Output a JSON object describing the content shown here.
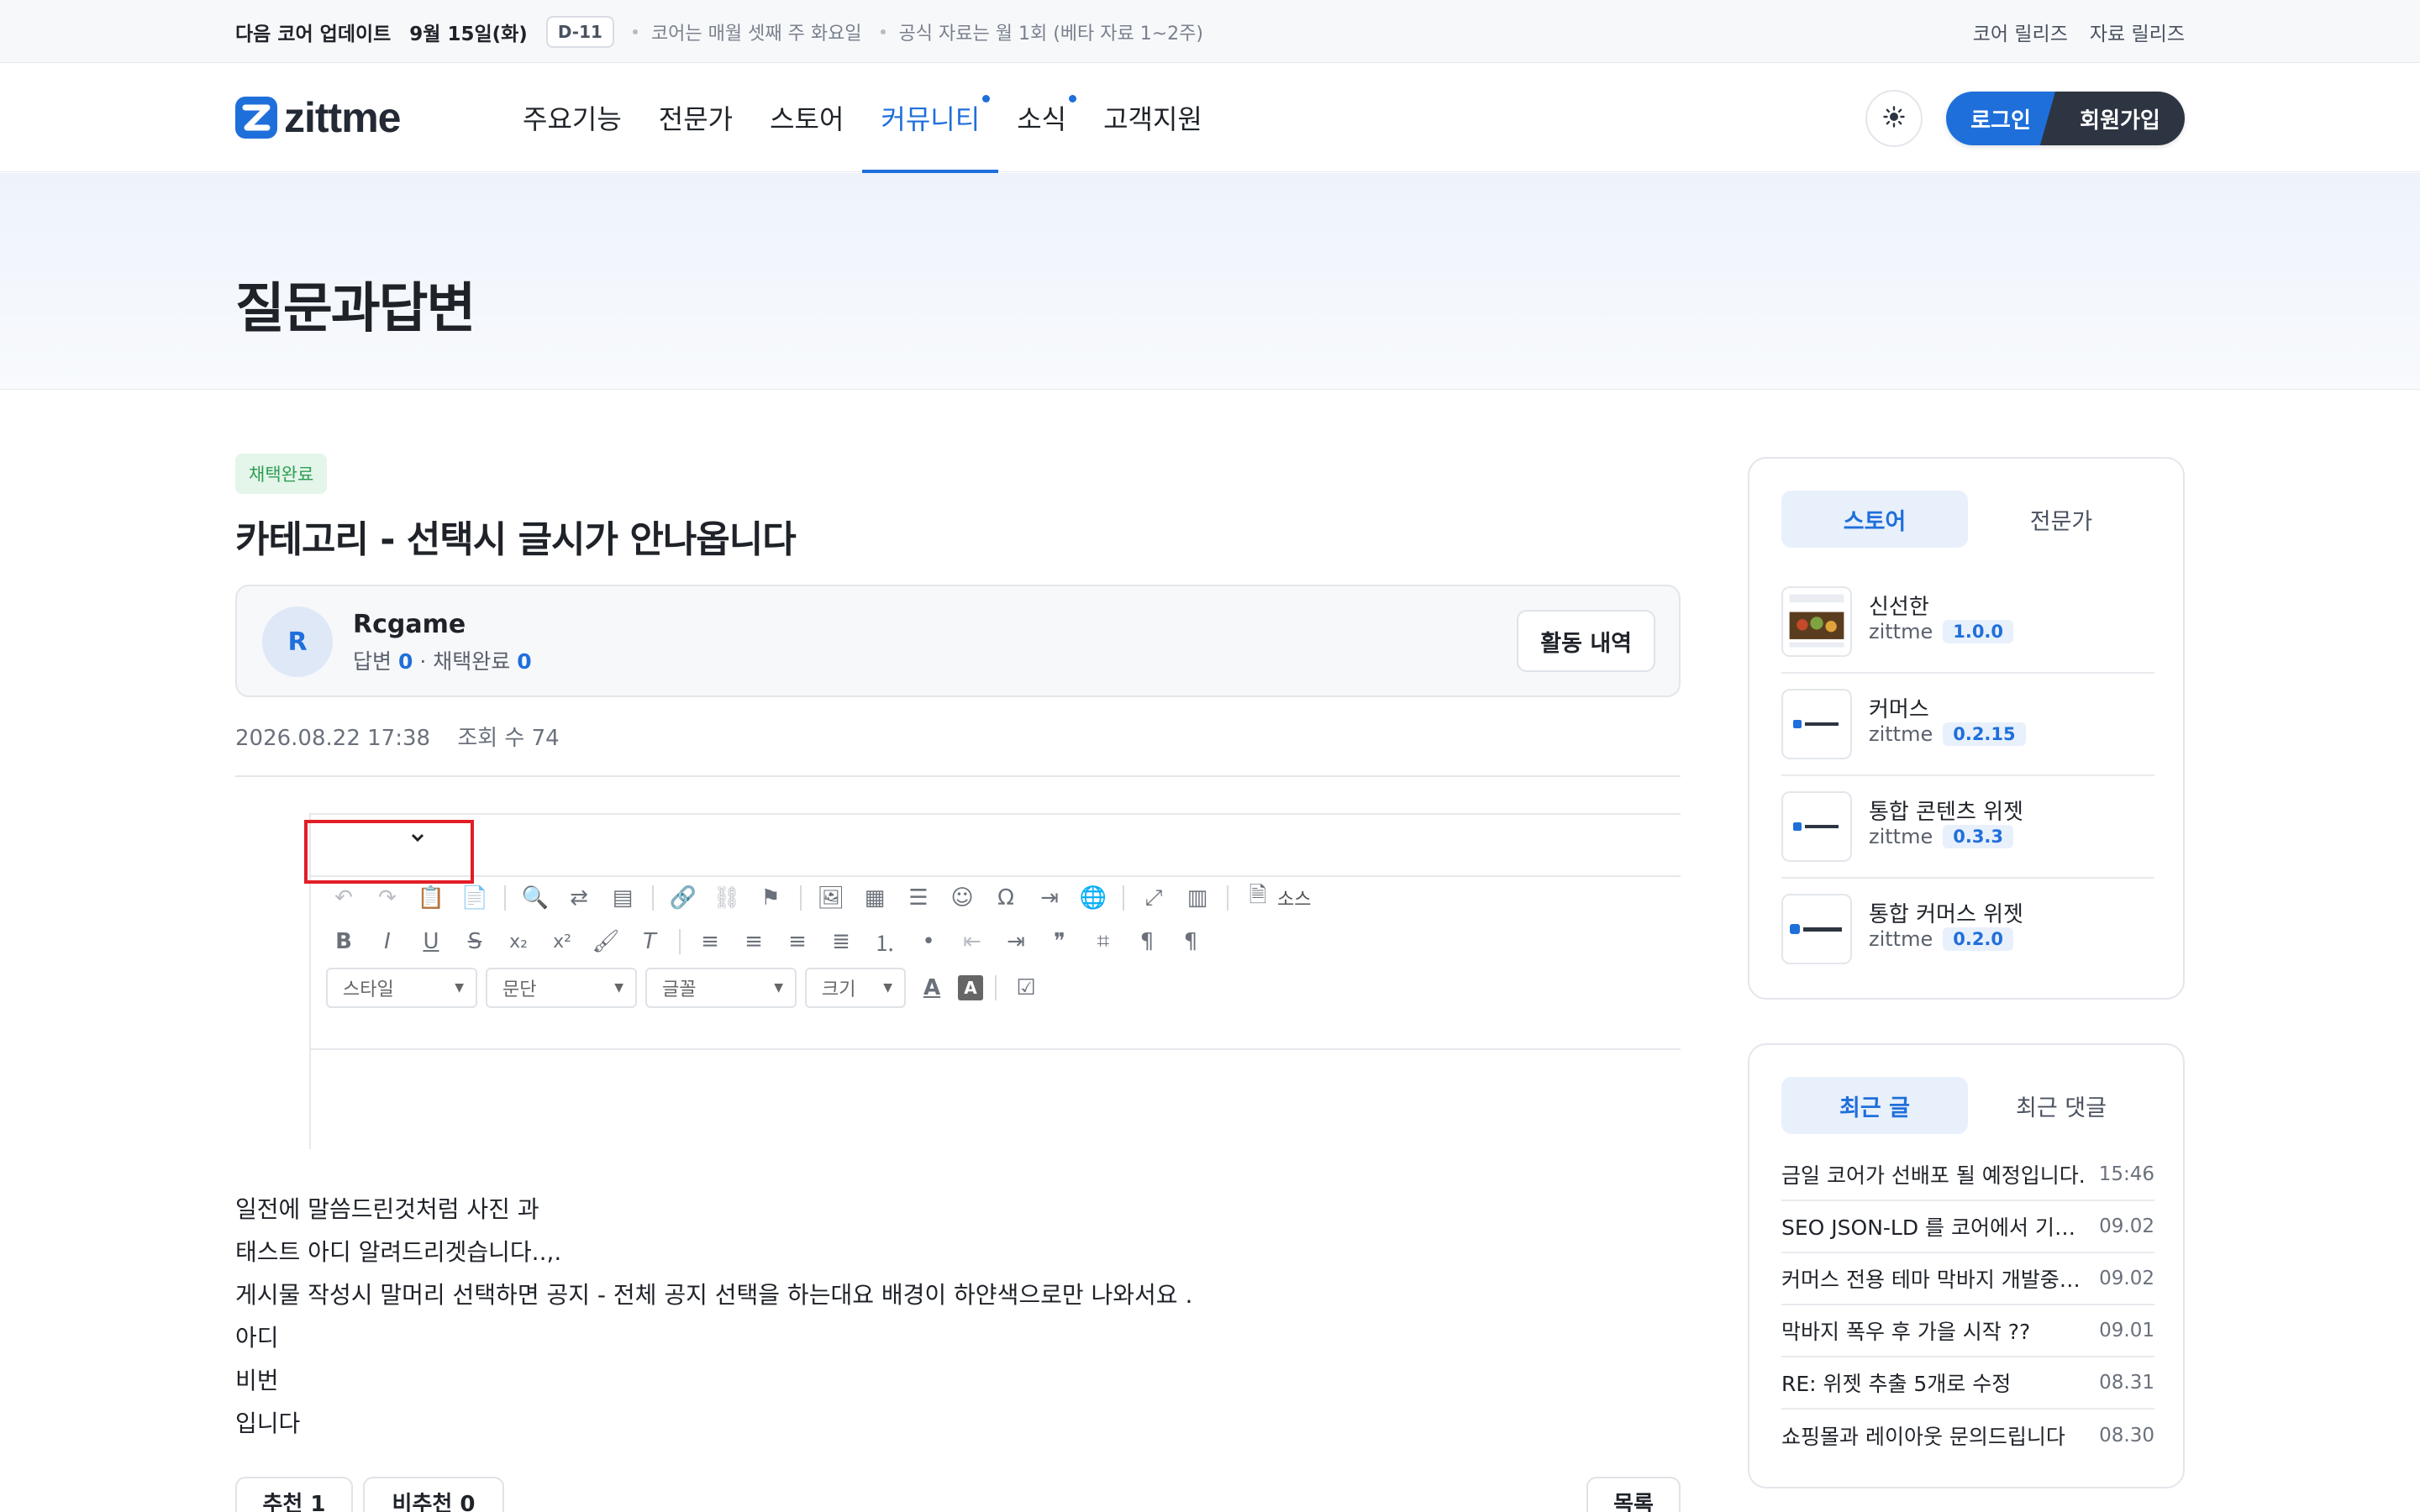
{
  "topbar": {
    "label": "다음 코어 업데이트",
    "date": "9월 15일(화)",
    "dday": "D-11",
    "notes": [
      "코어는 매월 셋째 주 화요일",
      "공식 자료는 월 1회 (베타 자료 1~2주)"
    ],
    "links": [
      "코어 릴리즈",
      "자료 릴리즈"
    ]
  },
  "header": {
    "logo": "zittme",
    "nav": [
      {
        "label": "주요기능",
        "dot": false,
        "active": false
      },
      {
        "label": "전문가",
        "dot": false,
        "active": false
      },
      {
        "label": "스토어",
        "dot": false,
        "active": false
      },
      {
        "label": "커뮤니티",
        "dot": true,
        "active": true
      },
      {
        "label": "소식",
        "dot": true,
        "active": false
      },
      {
        "label": "고객지원",
        "dot": false,
        "active": false
      }
    ],
    "login_label": "로그인",
    "signup_label": "회원가입",
    "theme_icon": "sun-icon"
  },
  "page": {
    "title": "질문과답변"
  },
  "post": {
    "badge": "채택완료",
    "title": "카테고리 - 선택시 글시가 안나옵니다",
    "author": {
      "initial": "R",
      "name": "Rcgame",
      "answers_label": "답변",
      "answers": "0",
      "adopted_label": "· 채택완료",
      "adopted": "0",
      "activity_label": "활동 내역"
    },
    "date": "2026.08.22 17:38",
    "views": "조회 수 74",
    "editor": {
      "source_label": "소스",
      "combos": [
        "스타일",
        "문단",
        "글꼴",
        "크기"
      ]
    },
    "body": [
      "일전에 말씀드린것처럼 사진 과",
      "태스트 아디 알려드리겟습니다..,.",
      "게시물 작성시 말머리 선택하면 공지 - 전체 공지 선택을 하는대요 배경이 하얀색으로만 나와서요 .",
      "아디",
      "비번",
      "입니다"
    ],
    "recommend_label": "추천 1",
    "unrecommend_label": "비추천 0",
    "list_label": "목록"
  },
  "sidebar": {
    "store_tabs": [
      "스토어",
      "전문가"
    ],
    "store_items": [
      {
        "name": "신선한",
        "author": "zittme",
        "version": "1.0.0"
      },
      {
        "name": "커머스",
        "author": "zittme",
        "version": "0.2.15"
      },
      {
        "name": "통합 콘텐츠 위젯",
        "author": "zittme",
        "version": "0.3.3"
      },
      {
        "name": "통합 커머스 위젯",
        "author": "zittme",
        "version": "0.2.0"
      }
    ],
    "recent_tabs": [
      "최근 글",
      "최근 댓글"
    ],
    "recent_items": [
      {
        "title": "금일 코어가 선배포 될 예정입니다.",
        "date": "15:46"
      },
      {
        "title": "SEO JSON-LD 를 코어에서 기능 추가",
        "date": "09.02"
      },
      {
        "title": "커머스 전용 테마 막바지 개발중입니다",
        "date": "09.02"
      },
      {
        "title": "막바지 폭우 후 가을 시작 ??",
        "date": "09.01"
      },
      {
        "title": "RE: 위젯 추출 5개로 수정",
        "date": "08.31"
      },
      {
        "title": "쇼핑몰과 레이아웃 문의드립니다",
        "date": "08.30"
      }
    ]
  },
  "colors": {
    "accent": "#1f6fdb",
    "dark": "#2e3542",
    "success": "#2f9e55",
    "highlight": "#e11d25"
  }
}
